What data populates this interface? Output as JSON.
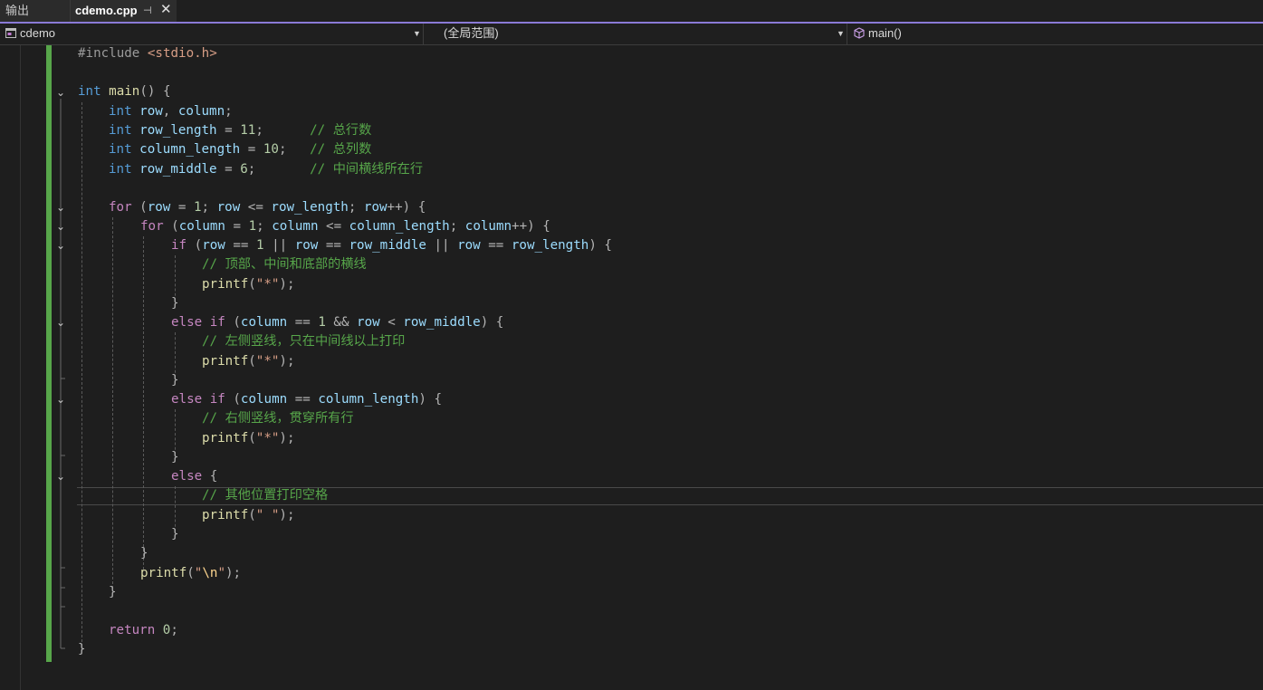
{
  "tabs": {
    "output_label": "输出",
    "active_label": "cdemo.cpp",
    "pin_glyph": "⊣",
    "close_glyph": "✕"
  },
  "nav": {
    "project": "cdemo",
    "scope": "(全局范围)",
    "member": "main()"
  },
  "colors": {
    "keyword": "#569cd6",
    "comment": "#57a64a",
    "string": "#d69d85",
    "number": "#b5cea8",
    "variable": "#9cdcfe",
    "function": "#dcdcaa",
    "change_bar": "#57a64a",
    "tab_accent": "#8a7ad6"
  },
  "code": {
    "include_directive": "#include",
    "include_file": "<stdio.h>",
    "kw_int": "int",
    "kw_for": "for",
    "kw_if": "if",
    "kw_else": "else",
    "kw_return": "return",
    "fn_main": "main",
    "fn_printf": "printf",
    "var_row": "row",
    "var_column": "column",
    "var_row_length": "row_length",
    "var_column_length": "column_length",
    "var_row_middle": "row_middle",
    "num_0": "0",
    "num_1": "1",
    "num_6": "6",
    "num_10": "10",
    "num_11": "11",
    "str_star": "\"*\"",
    "str_space": "\" \"",
    "str_quote": "\"",
    "str_escape_n": "\\n",
    "comment_total_rows": "// 总行数",
    "comment_total_cols": "// 总列数",
    "comment_middle_row": "// 中间横线所在行",
    "comment_horizontal": "// 顶部、中间和底部的横线",
    "comment_left": "// 左侧竖线，只在中间线以上打印",
    "comment_right": "// 右侧竖线，贯穿所有行",
    "comment_space": "// 其他位置打印空格"
  },
  "icons": {
    "project_icon": "cpp-project-icon",
    "member_icon": "cube-icon",
    "fold_icon": "chevron-down-icon"
  }
}
